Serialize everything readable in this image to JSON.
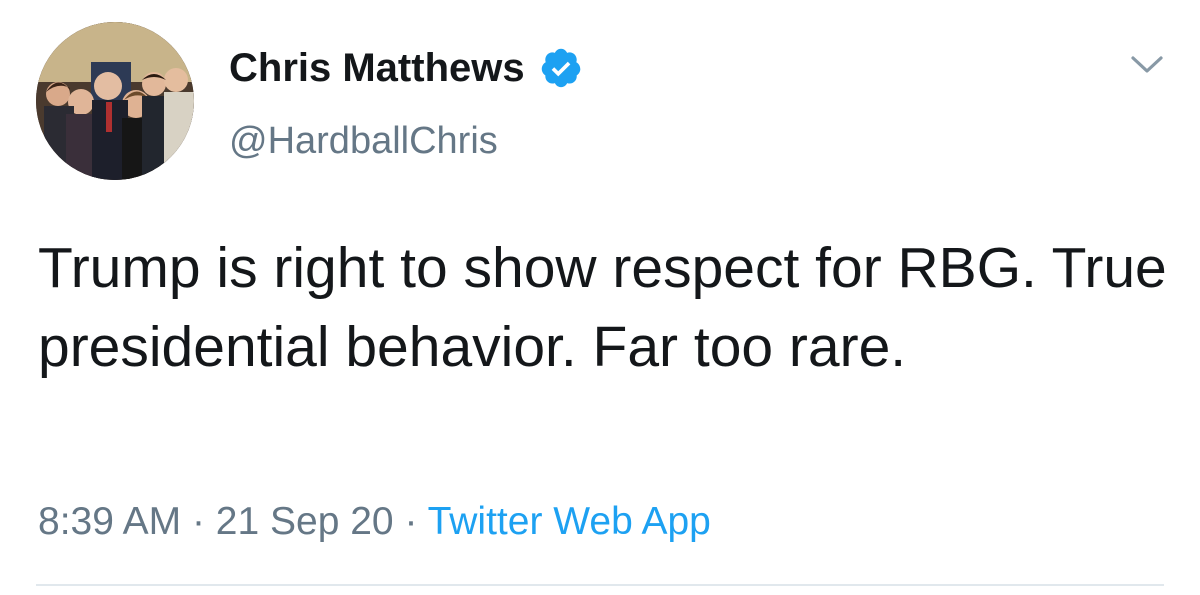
{
  "tweet": {
    "author": {
      "name": "Chris Matthews",
      "handle": "@HardballChris",
      "verified": true,
      "avatar_icon": "group-photo-avatar"
    },
    "text": "Trump is right to show respect for RBG. True presidential behavior. Far too rare.",
    "time": "8:39 AM",
    "date": "21 Sep 20",
    "separator": "·",
    "source": "Twitter Web App",
    "menu_icon": "chevron-down-icon"
  },
  "colors": {
    "text": "#14171a",
    "secondary": "#657786",
    "accent": "#1da1f2",
    "divider": "#e1e8ed"
  }
}
